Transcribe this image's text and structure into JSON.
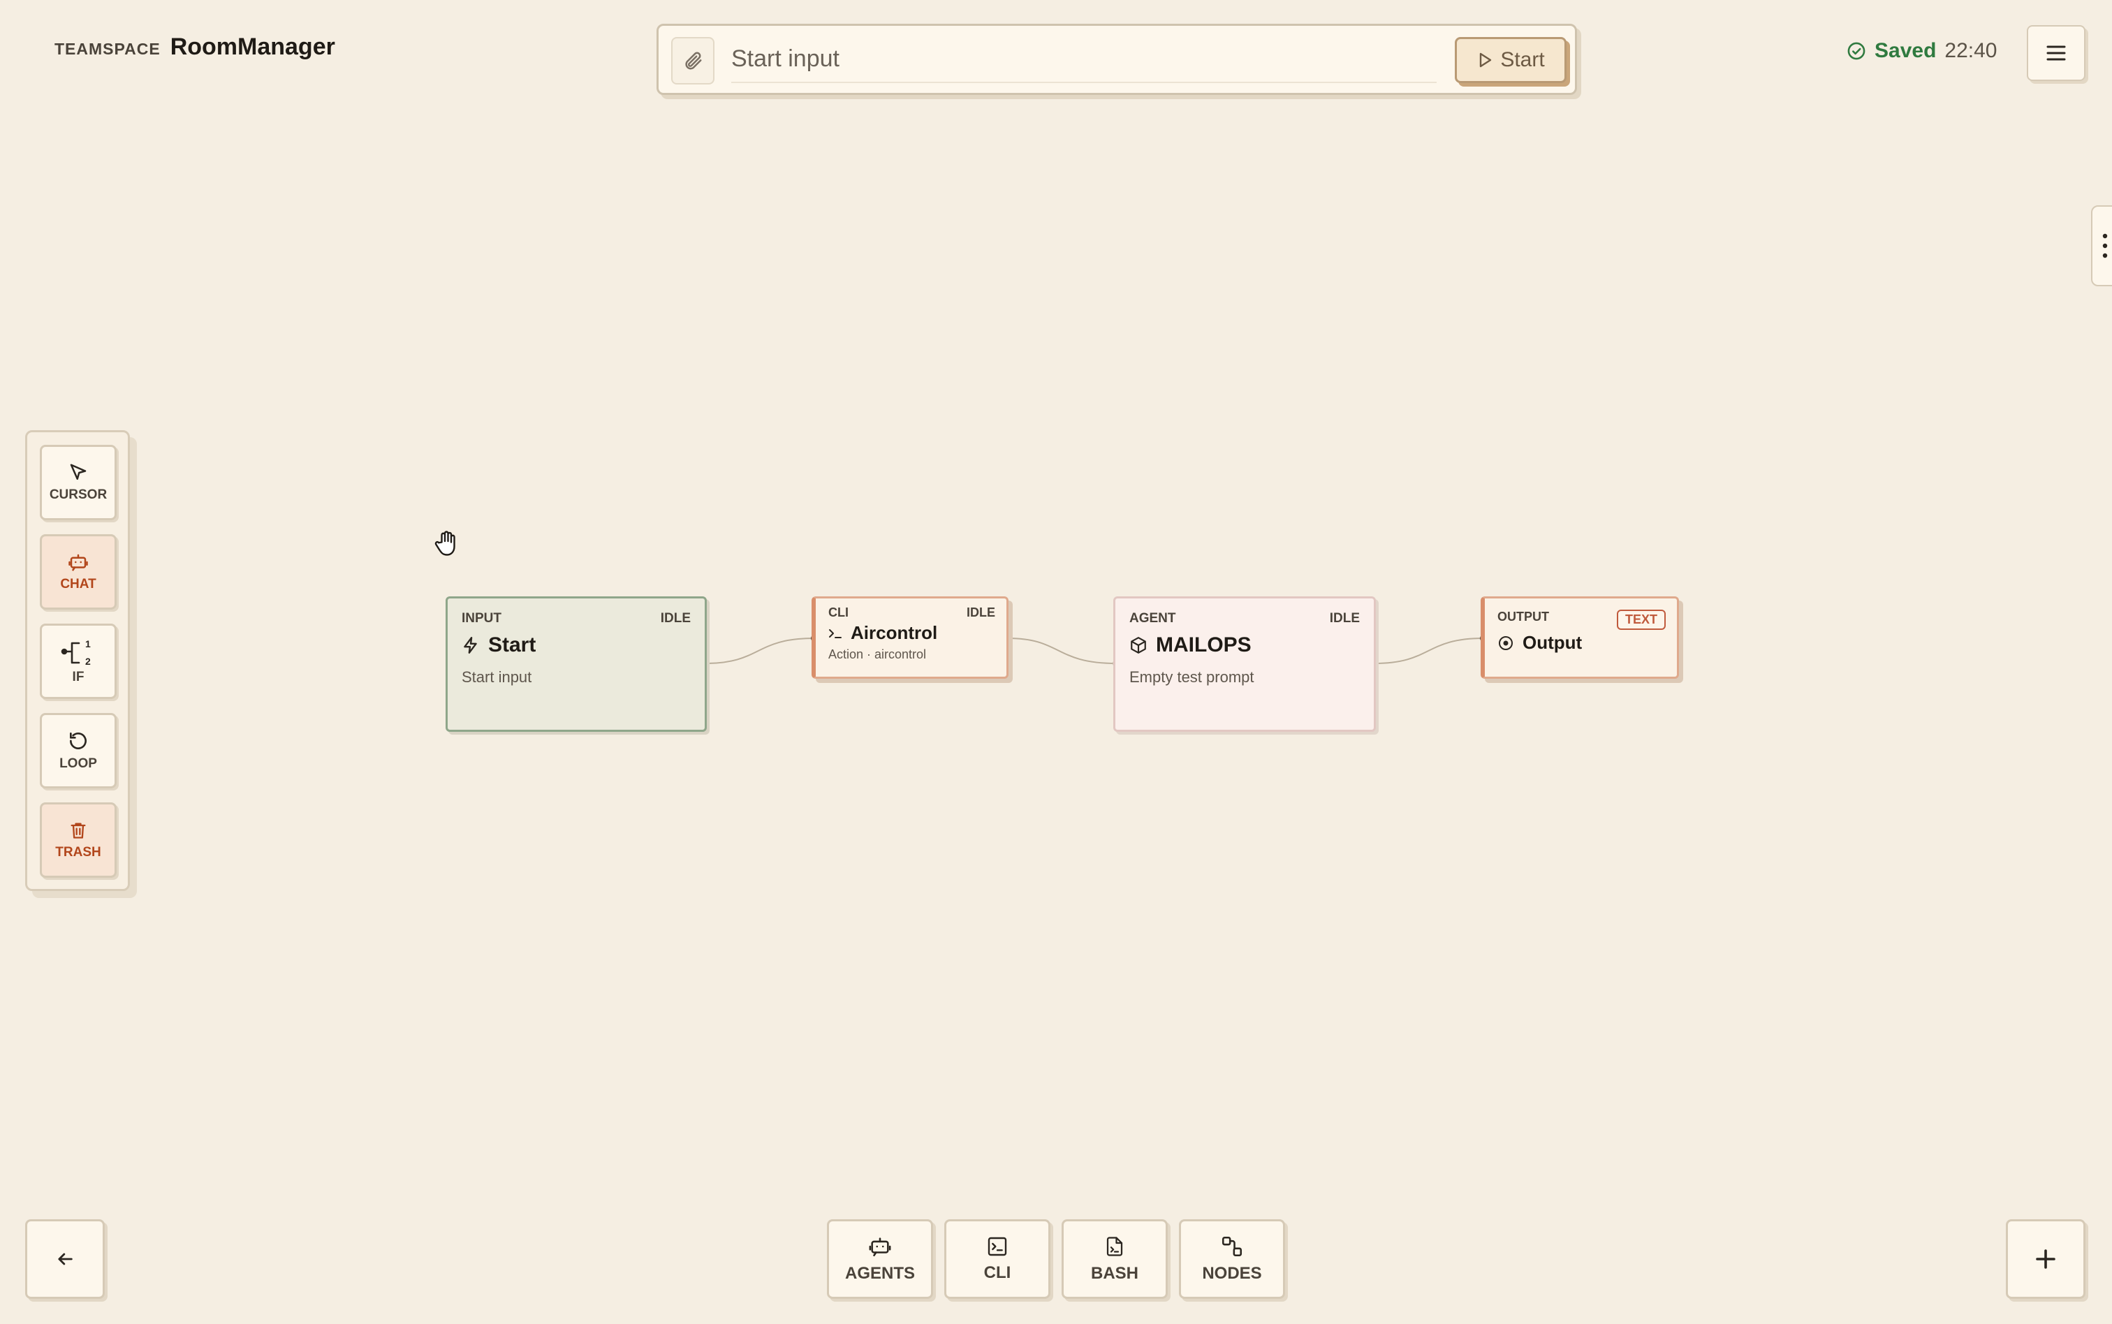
{
  "app": {
    "workspace_label": "TEAMSPACE",
    "name": "RoomManager"
  },
  "run_bar": {
    "placeholder": "Start input",
    "start_label": "Start"
  },
  "save_status": {
    "label": "Saved",
    "time": "22:40",
    "color": "#2f7a3f"
  },
  "toolbar": {
    "tools": [
      {
        "label": "CURSOR",
        "icon": "cursor-icon"
      },
      {
        "label": "CHAT",
        "icon": "chat-bot-icon"
      },
      {
        "label": "IF",
        "icon": "branch-icon"
      },
      {
        "label": "LOOP",
        "icon": "loop-icon"
      },
      {
        "label": "TRASH",
        "icon": "trash-icon"
      }
    ]
  },
  "nodes": {
    "input": {
      "type": "INPUT",
      "status": "IDLE",
      "title": "Start",
      "subtitle": "Start input",
      "icon": "lightning-icon"
    },
    "cli": {
      "type": "CLI",
      "status": "IDLE",
      "title": "Aircontrol",
      "subtitle": "Action · aircontrol",
      "icon": "terminal-prompt-icon"
    },
    "agent": {
      "type": "AGENT",
      "status": "IDLE",
      "title": "MAILOPS",
      "subtitle": "Empty test prompt",
      "icon": "cube-icon"
    },
    "output": {
      "type": "OUTPUT",
      "badge": "TEXT",
      "title": "Output",
      "icon": "target-icon"
    }
  },
  "bottom_bar": {
    "items": [
      {
        "label": "AGENTS",
        "icon": "agents-icon"
      },
      {
        "label": "CLI",
        "icon": "terminal-icon"
      },
      {
        "label": "BASH",
        "icon": "script-file-icon"
      },
      {
        "label": "NODES",
        "icon": "nodes-icon"
      }
    ]
  },
  "colors": {
    "background": "#f5eee2",
    "accent_red": "#b2461b",
    "success_green": "#2f7a3f"
  }
}
